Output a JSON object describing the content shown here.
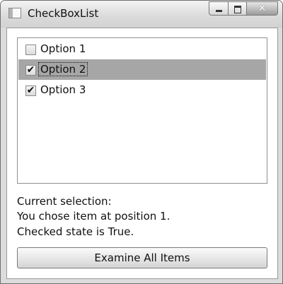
{
  "window": {
    "title": "CheckBoxList",
    "close_glyph": "✕"
  },
  "list": {
    "items": [
      {
        "label": "Option 1",
        "checked": false,
        "selected": false
      },
      {
        "label": "Option 2",
        "checked": true,
        "selected": true
      },
      {
        "label": "Option 3",
        "checked": true,
        "selected": false
      }
    ],
    "check_glyph": "✔"
  },
  "status": {
    "line1": "Current selection:",
    "line2": "You chose item at position 1.",
    "line3": "Checked state is True."
  },
  "button": {
    "label": "Examine All Items"
  }
}
